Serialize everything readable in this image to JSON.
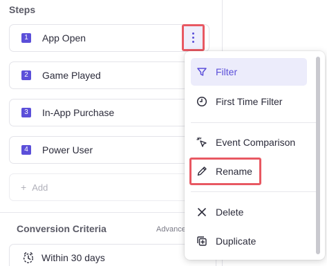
{
  "steps_section": {
    "title": "Steps",
    "steps": [
      {
        "num": "1",
        "label": "App Open"
      },
      {
        "num": "2",
        "label": "Game Played"
      },
      {
        "num": "3",
        "label": "In-App Purchase"
      },
      {
        "num": "4",
        "label": "Power User"
      }
    ],
    "add_label": "Add",
    "add_plus": "+"
  },
  "criteria": {
    "title": "Conversion Criteria",
    "advanced_link": "Advance",
    "within_label": "Within 30 days"
  },
  "menu": {
    "items": [
      {
        "label": "Filter",
        "icon": "filter-icon"
      },
      {
        "label": "First Time Filter",
        "icon": "clock-icon"
      },
      {
        "label": "Event Comparison",
        "icon": "cursor-sparkle-icon"
      },
      {
        "label": "Rename",
        "icon": "pencil-icon"
      },
      {
        "label": "Delete",
        "icon": "close-icon"
      },
      {
        "label": "Duplicate",
        "icon": "duplicate-icon"
      }
    ]
  },
  "colors": {
    "accent": "#5b4fd9",
    "highlight_border": "#e85862",
    "active_item_bg": "#ececfb"
  }
}
